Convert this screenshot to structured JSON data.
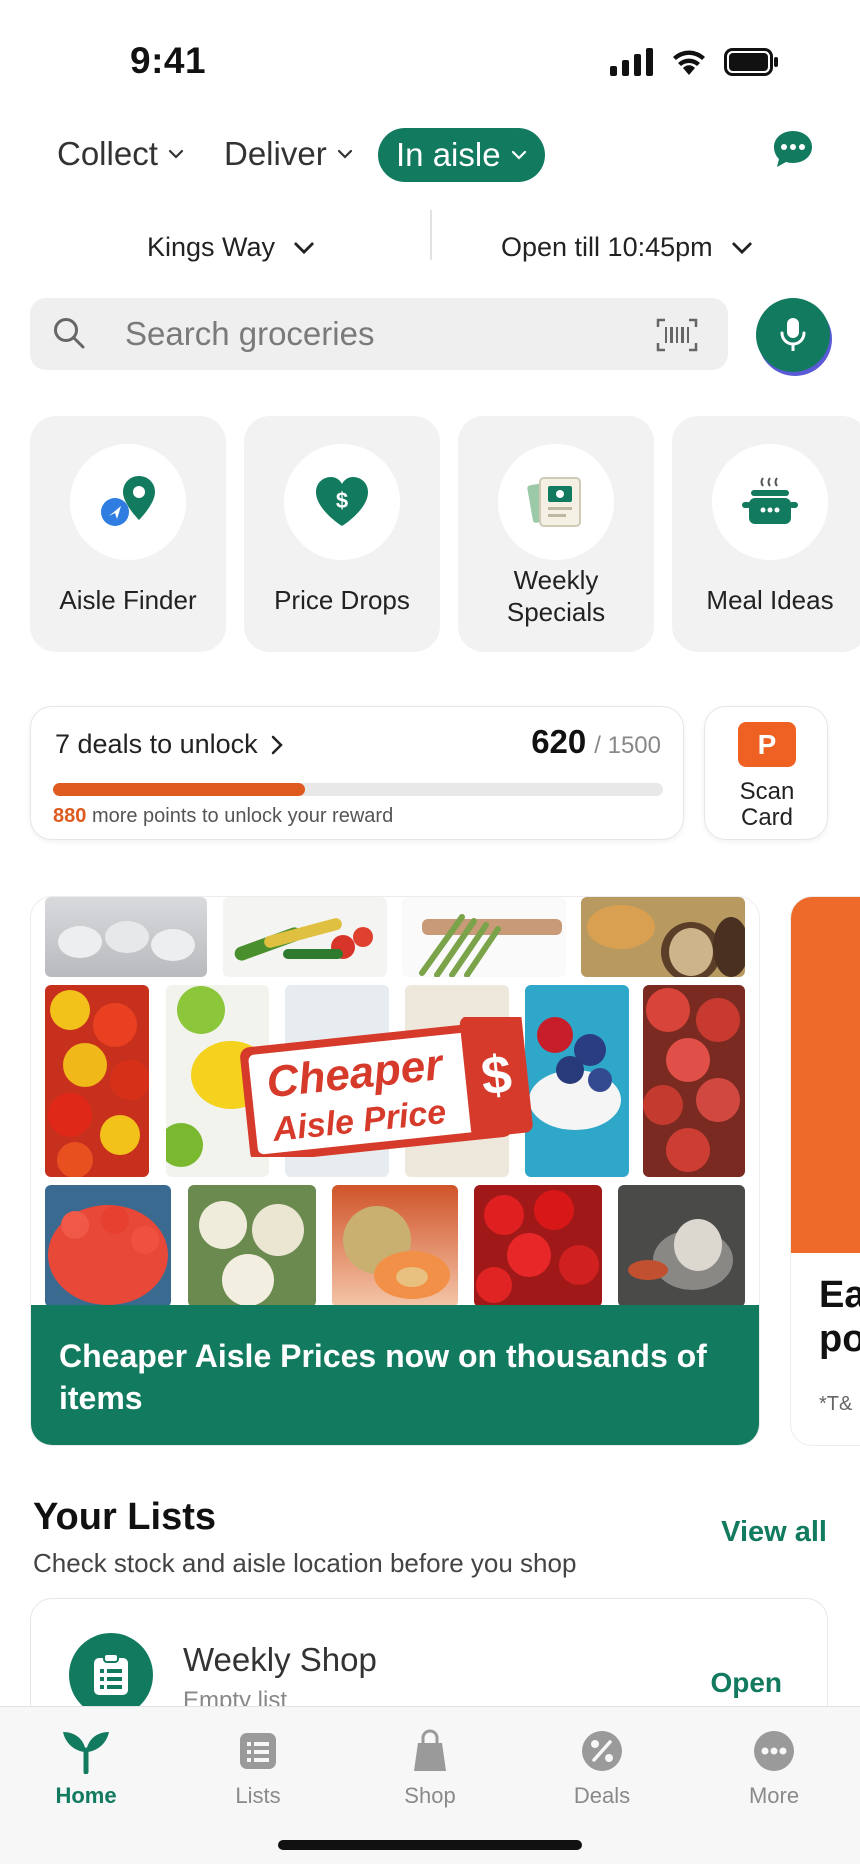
{
  "status_bar": {
    "time": "9:41"
  },
  "modes": [
    {
      "label": "Collect",
      "active": false
    },
    {
      "label": "Deliver",
      "active": false
    },
    {
      "label": "In aisle",
      "active": true
    }
  ],
  "store": {
    "name": "Kings Way",
    "hours": "Open till 10:45pm"
  },
  "search": {
    "placeholder": "Search groceries"
  },
  "tiles": [
    {
      "label": "Aisle Finder",
      "icon": "aisle-finder-pin-icon"
    },
    {
      "label": "Price Drops",
      "icon": "heart-dollar-icon"
    },
    {
      "label": "Weekly\nSpecials",
      "icon": "catalogue-icon"
    },
    {
      "label": "Meal Ideas",
      "icon": "cooking-pot-icon"
    }
  ],
  "rewards": {
    "deals_label": "7 deals to unlock",
    "points_current": "620",
    "points_total": "/ 1500",
    "progress_fraction": 0.413,
    "points_remaining": "880",
    "points_message": "more points to unlock your reward"
  },
  "scan_card": {
    "logo_letter": "P",
    "label": "Scan\nCard"
  },
  "promo": {
    "badge_line1": "Cheaper",
    "badge_line2": "Aisle Price",
    "badge_symbol": "$",
    "text": "Cheaper Aisle Prices now on thousands of items"
  },
  "promo2": {
    "title": "Ea\npo",
    "tc": "*T&"
  },
  "lists": {
    "title": "Your Lists",
    "subtitle": "Check stock and aisle location before you shop",
    "view_all": "View all",
    "items": [
      {
        "name": "Weekly Shop",
        "status": "Empty list",
        "action": "Open"
      }
    ]
  },
  "nav": [
    {
      "label": "Home",
      "active": true
    },
    {
      "label": "Lists",
      "active": false
    },
    {
      "label": "Shop",
      "active": false
    },
    {
      "label": "Deals",
      "active": false
    },
    {
      "label": "More",
      "active": false
    }
  ],
  "colors": {
    "brand_green": "#127a5f",
    "accent_orange": "#de5a1f",
    "badge_red": "#d63a2b"
  }
}
